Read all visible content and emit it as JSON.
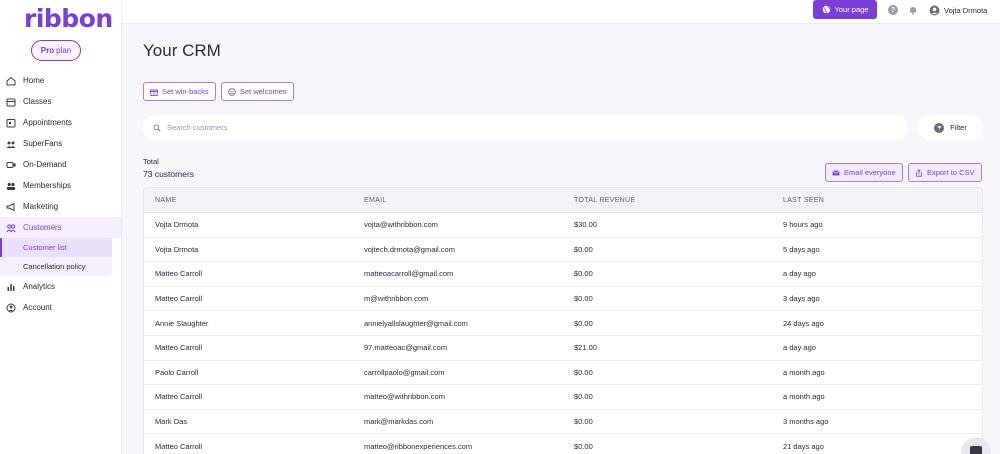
{
  "brand": {
    "logo": "ribbon",
    "plan_strong": "Pro",
    "plan_rest": "plan",
    "accent": "#7a3fd6"
  },
  "sidebar": {
    "items": [
      {
        "label": "Home",
        "icon": "home-icon"
      },
      {
        "label": "Classes",
        "icon": "calendar-icon"
      },
      {
        "label": "Appointments",
        "icon": "appointments-icon"
      },
      {
        "label": "SuperFans",
        "icon": "superfans-icon"
      },
      {
        "label": "On-Demand",
        "icon": "video-icon"
      },
      {
        "label": "Memberships",
        "icon": "memberships-icon"
      },
      {
        "label": "Marketing",
        "icon": "megaphone-icon"
      },
      {
        "label": "Customers",
        "icon": "customers-icon",
        "active": true
      },
      {
        "label": "Analytics",
        "icon": "analytics-icon"
      },
      {
        "label": "Account",
        "icon": "account-icon"
      }
    ],
    "customers_sub": [
      {
        "label": "Customer list",
        "active": true
      },
      {
        "label": "Cancellation policy"
      }
    ]
  },
  "topbar": {
    "your_page": "Your page",
    "help": "?",
    "user_name": "Vojta Drmota"
  },
  "main": {
    "title": "Your CRM",
    "set_winbacks": "Set win-backs",
    "set_welcomes": "Set welcomes",
    "search_placeholder": "Search customers",
    "filter": "Filter",
    "total_label": "Total",
    "total_count": "73 customers",
    "email_everyone": "Email everyone",
    "export_csv": "Export to CSV"
  },
  "table": {
    "headers": [
      "NAME",
      "EMAIL",
      "TOTAL REVENUE",
      "LAST SEEN"
    ],
    "rows": [
      [
        "Vojta Drmota",
        "vojta@withribbon.com",
        "$30.00",
        "9 hours ago"
      ],
      [
        "Vojta Drmota",
        "vojtech.drmota@gmail.com",
        "$0.00",
        "5 days ago"
      ],
      [
        "Matteo Carroll",
        "matteoacarroll@gmail.com",
        "$0.00",
        "a day ago"
      ],
      [
        "Matteo Carroll",
        "m@withribbon.com",
        "$0.00",
        "3 days ago"
      ],
      [
        "Annie Slaughter",
        "annielyallslaughter@gmail.com",
        "$0.00",
        "24 days ago"
      ],
      [
        "Matteo Carroll",
        "97.matteoac@gmail.com",
        "$21.00",
        "a day ago"
      ],
      [
        "Paolo Carroll",
        "carrollpaolo@gmail.com",
        "$0.00",
        "a month ago"
      ],
      [
        "Matteo Carroll",
        "matteo@withribbon.com",
        "$0.00",
        "a month ago"
      ],
      [
        "Mark Das",
        "mark@markdas.com",
        "$0.00",
        "3 months ago"
      ],
      [
        "Matteo Carroll",
        "matteo@ribbonexperiences.com",
        "$0.00",
        "21 days ago"
      ]
    ]
  }
}
